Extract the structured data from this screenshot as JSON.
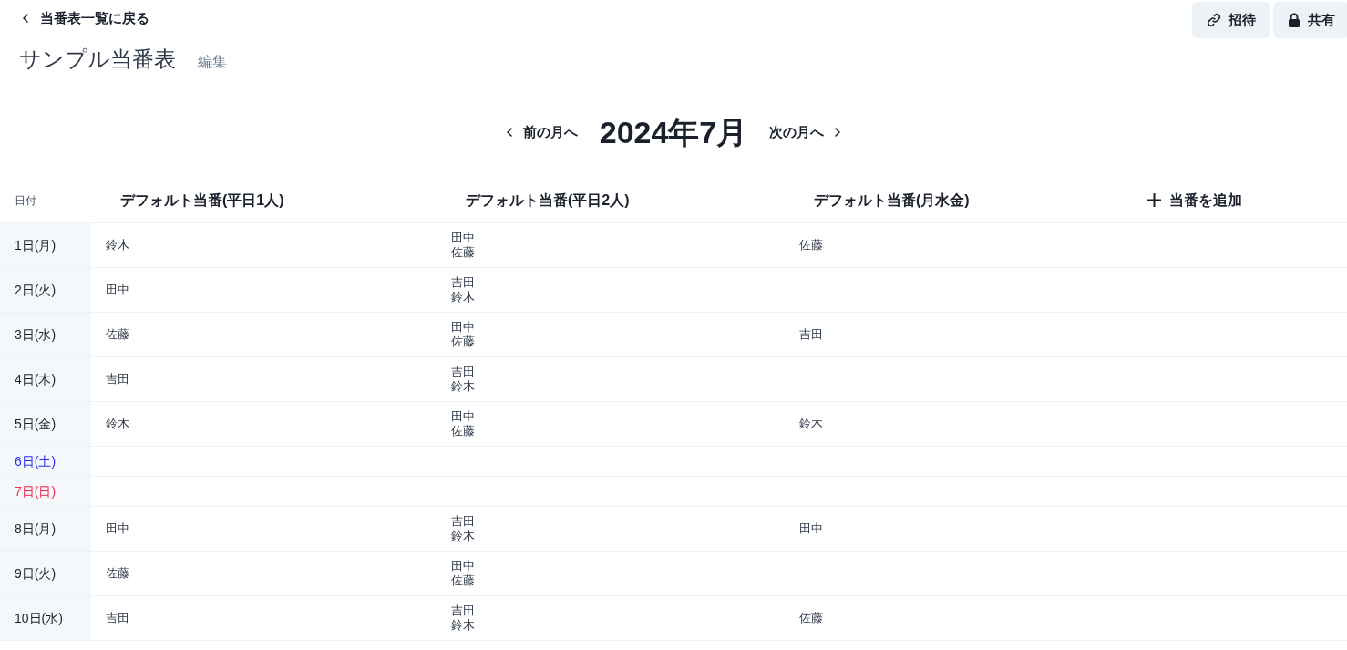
{
  "back_link": {
    "label": "当番表一覧に戻る"
  },
  "header_buttons": [
    {
      "kind": "invite",
      "label": "招待"
    },
    {
      "kind": "share",
      "label": "共有"
    }
  ],
  "roster": {
    "title": "サンプル当番表",
    "edit_link": "編集"
  },
  "month_nav": {
    "previous": "前の月へ",
    "current": "2024年7月",
    "next": "次の月へ"
  },
  "table": {
    "date_column": "日付",
    "columns": [
      "デフォルト当番(平日1人)",
      "デフォルト当番(平日2人)",
      "デフォルト当番(月水金)"
    ],
    "add_column": "当番を追加",
    "rows": [
      {
        "date": "1日(月)",
        "kind": "weekday",
        "cells": [
          [
            "鈴木"
          ],
          [
            "田中",
            "佐藤"
          ],
          [
            "佐藤"
          ]
        ]
      },
      {
        "date": "2日(火)",
        "kind": "weekday",
        "cells": [
          [
            "田中"
          ],
          [
            "吉田",
            "鈴木"
          ],
          []
        ]
      },
      {
        "date": "3日(水)",
        "kind": "weekday",
        "cells": [
          [
            "佐藤"
          ],
          [
            "田中",
            "佐藤"
          ],
          [
            "吉田"
          ]
        ]
      },
      {
        "date": "4日(木)",
        "kind": "weekday",
        "cells": [
          [
            "吉田"
          ],
          [
            "吉田",
            "鈴木"
          ],
          []
        ]
      },
      {
        "date": "5日(金)",
        "kind": "weekday",
        "cells": [
          [
            "鈴木"
          ],
          [
            "田中",
            "佐藤"
          ],
          [
            "鈴木"
          ]
        ]
      },
      {
        "date": "6日(土)",
        "kind": "saturday",
        "cells": [
          [],
          [],
          []
        ]
      },
      {
        "date": "7日(日)",
        "kind": "sunday",
        "cells": [
          [],
          [],
          []
        ]
      },
      {
        "date": "8日(月)",
        "kind": "weekday",
        "cells": [
          [
            "田中"
          ],
          [
            "吉田",
            "鈴木"
          ],
          [
            "田中"
          ]
        ]
      },
      {
        "date": "9日(火)",
        "kind": "weekday",
        "cells": [
          [
            "佐藤"
          ],
          [
            "田中",
            "佐藤"
          ],
          []
        ]
      },
      {
        "date": "10日(水)",
        "kind": "weekday",
        "cells": [
          [
            "吉田"
          ],
          [
            "吉田",
            "鈴木"
          ],
          [
            "佐藤"
          ]
        ]
      }
    ]
  }
}
